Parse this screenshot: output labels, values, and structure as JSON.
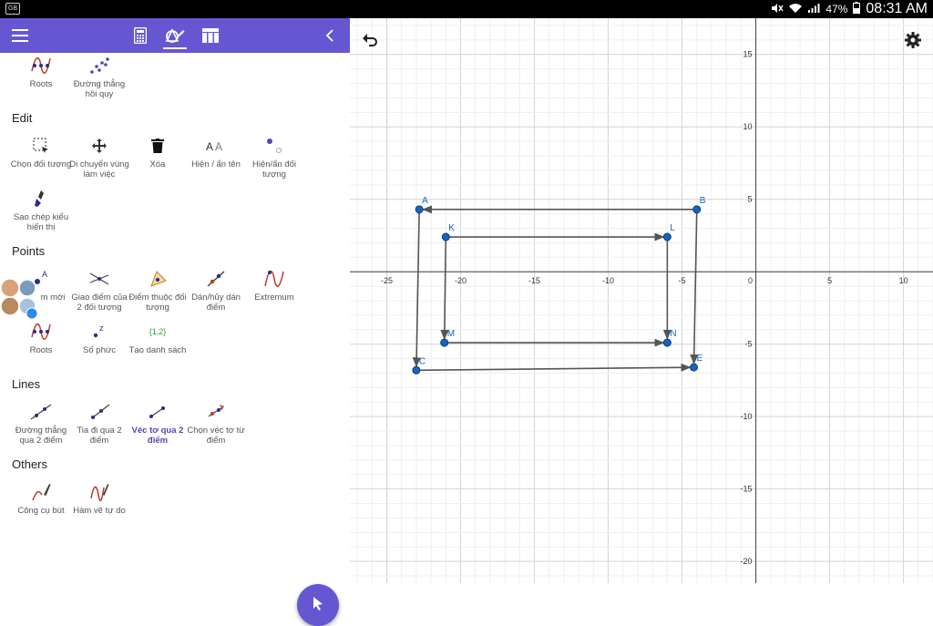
{
  "status_bar": {
    "battery": "47%",
    "time": "08:31 AM",
    "app_icon": "GB"
  },
  "toolbar": {
    "menu_icon": "hamburger-icon",
    "tabs": [
      "calculator-icon",
      "tools-icon",
      "table-icon"
    ],
    "collapse_icon": "chevron-left-icon"
  },
  "sidebar": {
    "top_tools": [
      {
        "label": "Roots",
        "icon": "roots-icon"
      },
      {
        "label": "Đường thẳng hồi quy",
        "icon": "regression-icon"
      }
    ],
    "sections": [
      {
        "title": "Edit",
        "tools": [
          {
            "label": "Chọn đối tượng",
            "icon": "select-icon"
          },
          {
            "label": "Di chuyển vùng làm việc",
            "icon": "move-icon"
          },
          {
            "label": "Xóa",
            "icon": "trash-icon"
          },
          {
            "label": "Hiện / ẩn tên",
            "icon": "label-icon"
          },
          {
            "label": "Hiện/ẩn đối tượng",
            "icon": "show-hide-icon"
          },
          {
            "label": "Sao chép kiểu hiển thị",
            "icon": "brush-icon"
          }
        ]
      },
      {
        "title": "Points",
        "tools": [
          {
            "label": "m mới",
            "icon": "point-icon"
          },
          {
            "label": "Giao điểm của 2 đối tượng",
            "icon": "intersect-icon"
          },
          {
            "label": "Điểm thuộc đối tượng",
            "icon": "point-on-object-icon"
          },
          {
            "label": "Dán/hủy dán điểm",
            "icon": "attach-icon"
          },
          {
            "label": "Extremum",
            "icon": "extremum-icon"
          },
          {
            "label": "Roots",
            "icon": "roots-icon"
          },
          {
            "label": "Số phức",
            "icon": "complex-icon"
          },
          {
            "label": "Tạo danh sách",
            "icon": "list-icon",
            "glyph": "{1,2}"
          }
        ]
      },
      {
        "title": "Lines",
        "tools": [
          {
            "label": "Đường thẳng qua 2 điểm",
            "icon": "line-icon"
          },
          {
            "label": "Tia đi qua 2 điểm",
            "icon": "ray-icon"
          },
          {
            "label": "Véc tơ qua 2 điểm",
            "icon": "vector-icon",
            "selected": true
          },
          {
            "label": "Chọn véc tơ từ điểm",
            "icon": "vector-from-point-icon"
          }
        ]
      },
      {
        "title": "Others",
        "tools": [
          {
            "label": "Công cụ bút",
            "icon": "pen-icon"
          },
          {
            "label": "Hàm vẽ tự do",
            "icon": "freehand-icon"
          }
        ]
      }
    ],
    "fab_icon": "cursor-icon"
  },
  "graph": {
    "x_ticks": [
      "-25",
      "-20",
      "-15",
      "-10",
      "-5",
      "0",
      "5",
      "10"
    ],
    "y_ticks": [
      "15",
      "10",
      "5",
      "-5",
      "-10",
      "-15",
      "-20"
    ],
    "xlim": [
      -27.5,
      12
    ],
    "ylim": [
      -21.5,
      17.5
    ],
    "points": [
      {
        "name": "A",
        "x": -22.8,
        "y": 4.3
      },
      {
        "name": "B",
        "x": -4,
        "y": 4.3
      },
      {
        "name": "C",
        "x": -23,
        "y": -6.8
      },
      {
        "name": "E",
        "x": -4.2,
        "y": -6.6
      },
      {
        "name": "K",
        "x": -21,
        "y": 2.4
      },
      {
        "name": "L",
        "x": -6,
        "y": 2.4
      },
      {
        "name": "M",
        "x": -21.1,
        "y": -4.9
      },
      {
        "name": "N",
        "x": -6,
        "y": -4.9
      }
    ],
    "vectors": [
      [
        "B",
        "A"
      ],
      [
        "A",
        "C"
      ],
      [
        "C",
        "E"
      ],
      [
        "B",
        "E"
      ],
      [
        "K",
        "L"
      ],
      [
        "K",
        "M"
      ],
      [
        "M",
        "N"
      ],
      [
        "L",
        "N"
      ]
    ]
  }
}
